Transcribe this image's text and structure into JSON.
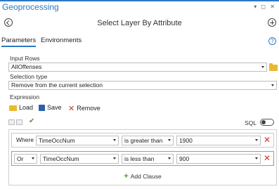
{
  "window": {
    "title": "Geoprocessing",
    "controls": "▾ ◻ ✕"
  },
  "header": {
    "tool_title": "Select Layer By Attribute"
  },
  "tabs": [
    {
      "label": "Parameters",
      "active": true
    },
    {
      "label": "Environments",
      "active": false
    }
  ],
  "params": {
    "input_rows": {
      "label": "Input Rows",
      "value": "AllOffenses"
    },
    "selection_type": {
      "label": "Selection type",
      "value": "Remove from the current selection"
    },
    "expression": {
      "label": "Expression"
    }
  },
  "expr_tools": {
    "load": "Load",
    "save": "Save",
    "remove": "Remove"
  },
  "sql": {
    "label": "SQL",
    "enabled": false
  },
  "clauses": [
    {
      "connector": "Where",
      "field": "TimeOccNum",
      "operator": "is greater than",
      "value": "1900"
    },
    {
      "connector": "Or",
      "field": "TimeOccNum",
      "operator": "is less than",
      "value": "900"
    }
  ],
  "add_clause_label": "Add Clause",
  "colors": {
    "accent": "#2b79c2",
    "delete": "#c9381f",
    "add": "#4a9a2f"
  }
}
